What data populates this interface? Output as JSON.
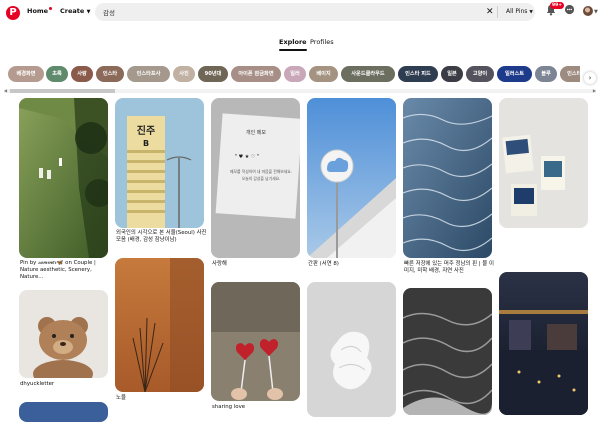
{
  "header": {
    "logo": "P",
    "home": "Home",
    "create": "Create",
    "search_value": "감성",
    "search_clear": "✕",
    "filter": "All Pins",
    "notif_badge": "99+"
  },
  "tabs": [
    {
      "label": "Explore",
      "active": true
    },
    {
      "label": "Profiles",
      "active": false
    }
  ],
  "chips": [
    {
      "label": "배경화면",
      "color": "#b59a8f"
    },
    {
      "label": "초록",
      "color": "#5f8a6c"
    },
    {
      "label": "사랑",
      "color": "#8a5a4a"
    },
    {
      "label": "인스타",
      "color": "#8c6a59"
    },
    {
      "label": "인스타프사",
      "color": "#a5988c"
    },
    {
      "label": "사진",
      "color": "#c1b1a3"
    },
    {
      "label": "90년대",
      "color": "#6f6656"
    },
    {
      "label": "아이폰 잠금화면",
      "color": "#a78f87"
    },
    {
      "label": "일러",
      "color": "#c9a7b8"
    },
    {
      "label": "베이지",
      "color": "#a59381"
    },
    {
      "label": "사운드클라우드",
      "color": "#6c6e5f"
    },
    {
      "label": "인스타 피드",
      "color": "#2f3d50"
    },
    {
      "label": "일본",
      "color": "#3c3c44"
    },
    {
      "label": "고양이",
      "color": "#54535d"
    },
    {
      "label": "일러스트",
      "color": "#1e3a8a"
    },
    {
      "label": "블루",
      "color": "#7d8594"
    },
    {
      "label": "인스타 하이",
      "color": "#9d8b80"
    }
  ],
  "pins": [
    {
      "caption": "Pin by ",
      "user": "𝓈𝓊𝓂𝓂𝑒𝓇🦋",
      "caption_rest": " on Couple | Nature aesthetic, Scenery, Nature..."
    },
    {
      "caption": "외국인의 시각으로 본 서울(Seoul) 사진 모음 (배경, 감성 잠냥이남)"
    },
    {
      "caption": "사랑해"
    },
    {
      "caption": "간판 (서연 8)"
    },
    {
      "caption": "빠른 저장에 있는 머주 정남의 핀 | 물 이미지, 미학 배경, 자연 사진"
    },
    {
      "caption": ""
    },
    {
      "caption": "dhyuckletter"
    },
    {
      "caption": "노을"
    },
    {
      "caption": "sharing love"
    }
  ],
  "pin_images": {
    "p1_sign_line1": "진주",
    "p1_sign_line2": "B",
    "p3_title": "개인 메모",
    "p3_line1": "\" ♥ ★ ♡ \"",
    "p3_line2": "메모를 작성하여 내 마음을 전해보세요.",
    "p3_line3": "오늘의 감성을 남기세요."
  }
}
